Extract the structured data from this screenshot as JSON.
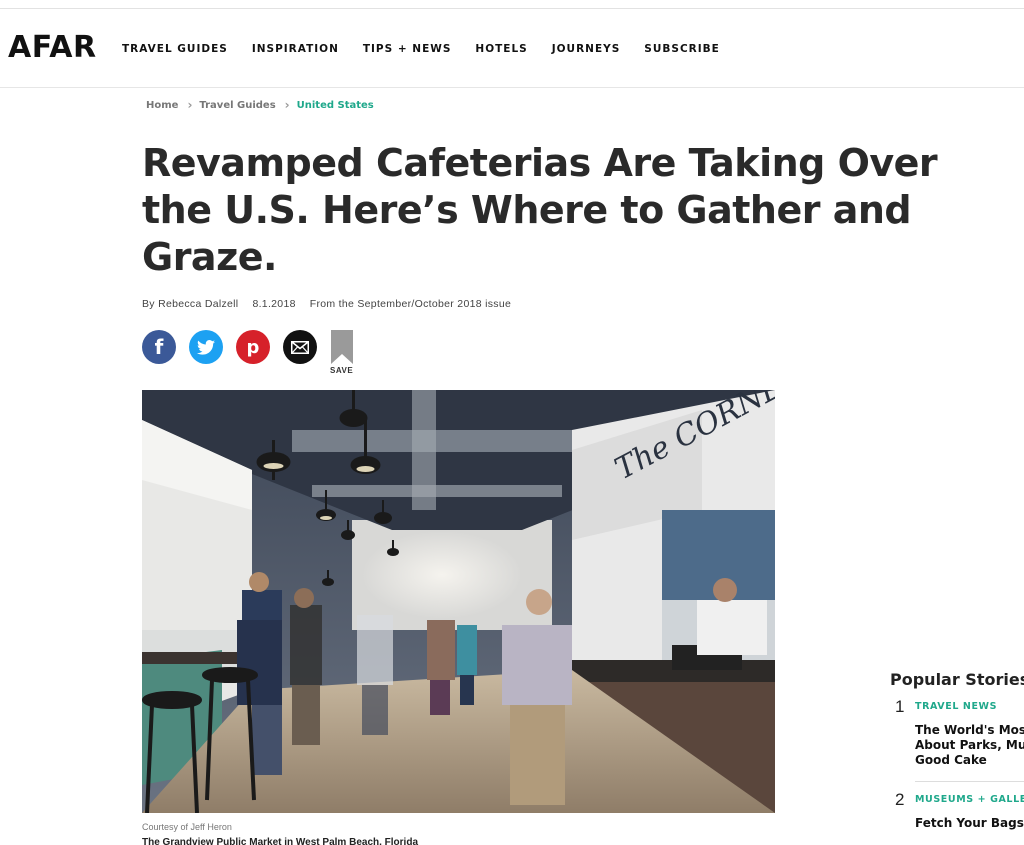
{
  "brand": {
    "logo": "AFAR"
  },
  "nav": {
    "items": [
      "TRAVEL GUIDES",
      "INSPIRATION",
      "TIPS + NEWS",
      "HOTELS",
      "JOURNEYS",
      "SUBSCRIBE"
    ]
  },
  "breadcrumb": [
    "Home",
    "Travel Guides",
    "United States"
  ],
  "article": {
    "title": "Revamped Cafeterias Are Taking Over the U.S. Here’s Where to Gather and Graze.",
    "byline": "By Rebecca Dalzell",
    "date": "8.1.2018",
    "issue": "From the September/October 2018 issue",
    "save_label": "SAVE",
    "photo_credit": "Courtesy of Jeff Heron",
    "photo_caption": "The Grandview Public Market in West Palm Beach, Florida"
  },
  "share": {
    "facebook_glyph": "f",
    "pinterest_glyph": "p"
  },
  "hero_sign": "The CORNER",
  "popular": {
    "heading": "Popular Stories",
    "items": [
      {
        "num": "1",
        "category": "TRAVEL NEWS",
        "title": "The World's Most\nAbout Parks, Mus\nGood Cake"
      },
      {
        "num": "2",
        "category": "MUSEUMS + GALLERIES",
        "title": "Fetch Your Bags."
      }
    ]
  },
  "colors": {
    "accent": "#1fa88b",
    "facebook": "#3b5998",
    "twitter": "#1da1f2",
    "pinterest": "#d6212a"
  }
}
